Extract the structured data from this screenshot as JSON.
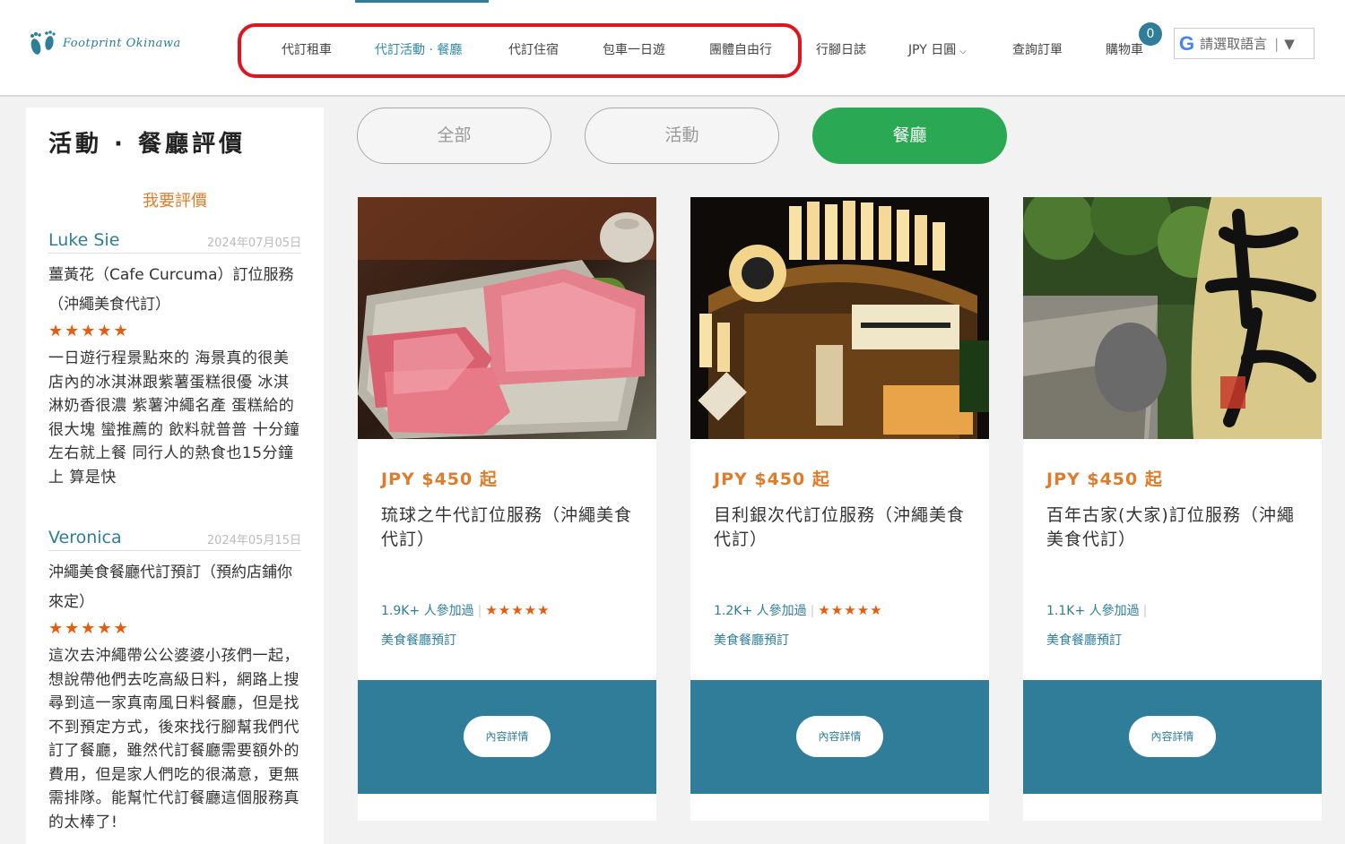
{
  "header": {
    "logo_text": "Footprint Okinawa",
    "nav": [
      {
        "label": "代訂租車"
      },
      {
        "label": "代訂活動 · 餐廳"
      },
      {
        "label": "代訂住宿"
      },
      {
        "label": "包車一日遊"
      },
      {
        "label": "團體自由行"
      },
      {
        "label": "行腳日誌"
      },
      {
        "label": "JPY 日圓"
      },
      {
        "label": "查詢訂單"
      },
      {
        "label": "購物車"
      }
    ],
    "cart_count": "0",
    "language_label": "請選取語言",
    "language_arrow": "▼"
  },
  "sidebar": {
    "title": "活動 · 餐廳評價",
    "write_review": "我要評價",
    "reviews": [
      {
        "name": "Luke Sie",
        "date": "2024年07月05日",
        "service": "薑黃花（Cafe Curcuma）訂位服務（沖繩美食代訂）",
        "stars": "★★★★★",
        "body": "一日遊行程景點來的 海景真的很美 店內的冰淇淋跟紫薯蛋糕很優 冰淇淋奶香很濃 紫薯沖繩名產 蛋糕給的很大塊 蠻推薦的 飲料就普普 十分鐘左右就上餐 同行人的熱食也15分鐘上 算是快"
      },
      {
        "name": "Veronica",
        "date": "2024年05月15日",
        "service": "沖繩美食餐廳代訂預訂（預約店鋪你來定）",
        "stars": "★★★★★",
        "body": "這次去沖繩帶公公婆婆小孩們一起，想說帶他們去吃高級日料，網路上搜尋到這一家真南風日料餐廳，但是找不到預定方式，後來找行腳幫我們代訂了餐廳，雖然代訂餐廳需要額外的費用，但是家人們吃的很滿意，更無需排隊。能幫忙代訂餐廳這個服務真的太棒了!"
      }
    ]
  },
  "filters": [
    {
      "label": "全部"
    },
    {
      "label": "活動"
    },
    {
      "label": "餐廳"
    }
  ],
  "cards": [
    {
      "price": "JPY $450 起",
      "title": "琉球之牛代訂位服務（沖繩美食代訂）",
      "participants": "1.9K+ 人參加過",
      "stars": "★★★★★",
      "category": "美食餐廳預訂",
      "button": "內容詳情"
    },
    {
      "price": "JPY $450 起",
      "title": "目利銀次代訂位服務（沖繩美食代訂）",
      "participants": "1.2K+ 人參加過",
      "stars": "★★★★★",
      "category": "美食餐廳預訂",
      "button": "內容詳情"
    },
    {
      "price": "JPY $450 起",
      "title": "百年古家(大家)訂位服務（沖繩美食代訂）",
      "participants": "1.1K+ 人參加過",
      "stars": "",
      "category": "美食餐廳預訂",
      "button": "內容詳情"
    }
  ],
  "colors": {
    "accent": "#2f7d98",
    "price": "#e07b2a",
    "active_filter": "#2aa853",
    "highlight_box": "#e0141e",
    "stars": "#e85a0c"
  },
  "icons": {
    "logo": "footprint-logo-icon",
    "currency_dropdown": "chevron-down-icon",
    "language": "google-g-icon"
  }
}
